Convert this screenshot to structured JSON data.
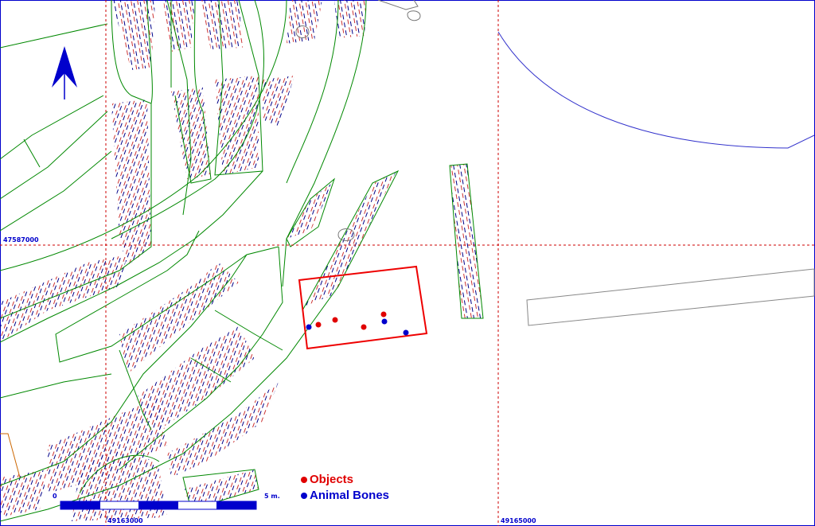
{
  "grid": {
    "y_label": "47587000",
    "x_label_left": "49163000",
    "x_label_right": "49165000"
  },
  "scale": {
    "start": "0",
    "end": "5 m."
  },
  "legend": {
    "objects_label": "Objects",
    "bones_label": "Animal Bones"
  },
  "colors": {
    "objects": "#e00000",
    "bones": "#0000cc",
    "outline": "#008800",
    "hatch_red": "#cc3333",
    "hatch_blue": "#000088",
    "grid": "#cc0000",
    "trench": "#ee0000",
    "north": "#0000cc"
  },
  "icons": {
    "north": "north-arrow-icon"
  }
}
